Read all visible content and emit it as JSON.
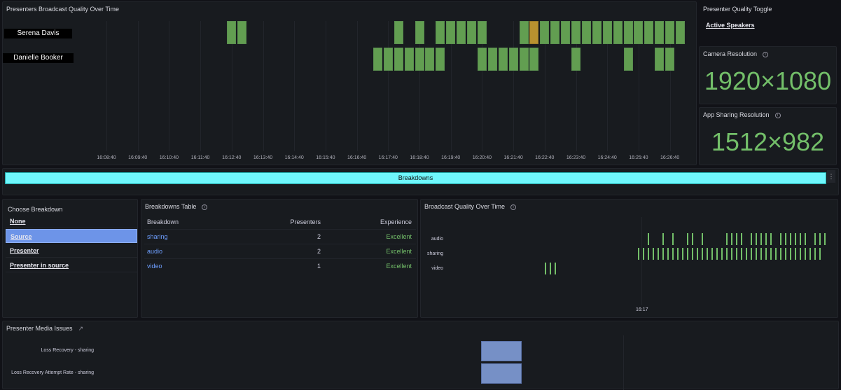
{
  "top_chart": {
    "title": "Presenters Broadcast Quality Over Time",
    "type": "state-timeline",
    "slot_seconds": 20,
    "x_ticks": [
      "16:08:40",
      "16:09:40",
      "16:10:40",
      "16:11:40",
      "16:12:40",
      "16:13:40",
      "16:14:40",
      "16:15:40",
      "16:16:40",
      "16:17:40",
      "16:18:40",
      "16:19:40",
      "16:20:40",
      "16:21:40",
      "16:22:40",
      "16:23:40",
      "16:24:40",
      "16:25:40",
      "16:26:40"
    ],
    "colors": {
      "good": "#629e51",
      "warning": "#b8912f"
    },
    "rows": [
      {
        "name": "Serena Davis",
        "segments": [
          {
            "start": "16:12:40",
            "end": "16:13:00",
            "state": "good"
          },
          {
            "start": "16:18:00",
            "end": "16:18:00",
            "state": "good"
          },
          {
            "start": "16:18:40",
            "end": "16:18:40",
            "state": "good"
          },
          {
            "start": "16:19:20",
            "end": "16:20:40",
            "state": "good"
          },
          {
            "start": "16:22:00",
            "end": "16:22:00",
            "state": "good"
          },
          {
            "start": "16:22:20",
            "end": "16:22:20",
            "state": "warning"
          },
          {
            "start": "16:22:40",
            "end": "16:27:00",
            "state": "good"
          }
        ]
      },
      {
        "name": "Danielle Booker",
        "segments": [
          {
            "start": "16:17:20",
            "end": "16:19:20",
            "state": "good"
          },
          {
            "start": "16:20:40",
            "end": "16:22:20",
            "state": "good"
          },
          {
            "start": "16:23:40",
            "end": "16:23:40",
            "state": "good"
          },
          {
            "start": "16:25:20",
            "end": "16:25:20",
            "state": "good"
          },
          {
            "start": "16:26:20",
            "end": "16:26:40",
            "state": "good"
          }
        ]
      }
    ]
  },
  "toggle": {
    "title": "Presenter Quality Toggle",
    "link": "Active Speakers"
  },
  "camera": {
    "title": "Camera Resolution",
    "value": "1920×1080"
  },
  "sharing_res": {
    "title": "App Sharing Resolution",
    "value": "1512×982"
  },
  "row_header": {
    "label": "Breakdowns",
    "color": "#6ff7fc"
  },
  "choose": {
    "title": "Choose Breakdown",
    "options": [
      "None",
      "Source",
      "Presenter",
      "Presenter in source"
    ],
    "selected": "Source"
  },
  "table": {
    "title": "Breakdowns Table",
    "columns": [
      "Breakdown",
      "Presenters",
      "Experience"
    ],
    "rows": [
      [
        "sharing",
        "2",
        "Excellent"
      ],
      [
        "audio",
        "2",
        "Excellent"
      ],
      [
        "video",
        "1",
        "Excellent"
      ]
    ]
  },
  "bq_chart": {
    "title": "Broadcast Quality Over Time",
    "type": "state-timeline",
    "x_ticks": [
      "16:17"
    ],
    "rows": [
      {
        "name": "audio",
        "times": [
          "16:17:20",
          "16:18:20",
          "16:19:00",
          "16:20:00",
          "16:20:20",
          "16:21:00",
          "16:22:40",
          "16:23:00",
          "16:23:20",
          "16:23:40",
          "16:24:20",
          "16:24:40",
          "16:25:00",
          "16:25:20",
          "16:25:40",
          "16:26:20",
          "16:26:40",
          "16:27:00",
          "16:27:20",
          "16:27:40",
          "16:28:00",
          "16:28:40",
          "16:29:00",
          "16:29:20"
        ]
      },
      {
        "name": "sharing",
        "range": [
          "16:16:40",
          "16:29:00"
        ]
      },
      {
        "name": "video",
        "times": [
          "16:10:20",
          "16:10:40",
          "16:11:00"
        ]
      }
    ]
  },
  "issues": {
    "title": "Presenter Media Issues",
    "rows": [
      "Loss Recovery - sharing",
      "Loss Recovery Attempt Rate - sharing"
    ],
    "color": "#7690c6"
  }
}
